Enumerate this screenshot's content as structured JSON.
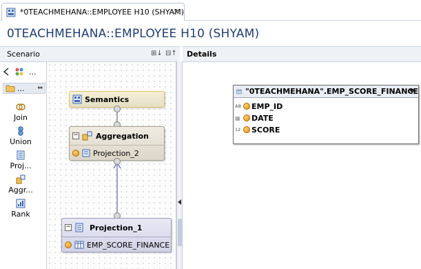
{
  "tab": {
    "label": "*0TEACHMEHANA::EMPLOYEE H10 (SHYAM)",
    "close_glyph": "✕"
  },
  "page_title": "0TEACHMEHANA::EMPLOYEE H10 (SHYAM)",
  "scenario": {
    "header": "Scenario",
    "header_buttons": [
      "⊞↓",
      "⊟↑"
    ],
    "palette_toolbar_more": "...",
    "palette_folder_label": "...",
    "tools": [
      {
        "label": "Join",
        "icon": "join-icon"
      },
      {
        "label": "Union",
        "icon": "union-icon"
      },
      {
        "label": "Proj...",
        "icon": "projection-icon"
      },
      {
        "label": "Aggr...",
        "icon": "aggregation-icon"
      },
      {
        "label": "Rank",
        "icon": "rank-icon"
      }
    ],
    "nodes": {
      "semantics": {
        "title": "Semantics"
      },
      "aggregation": {
        "title": "Aggregation",
        "input": "Projection_2"
      },
      "projection_1": {
        "title": "Projection_1",
        "input": "EMP_SCORE_FINANCE"
      }
    }
  },
  "details": {
    "header": "Details",
    "table": {
      "name": "\"0TEACHMEHANA\".EMP_SCORE_FINANCE",
      "columns": [
        {
          "name": "EMP_ID",
          "type_tag": "AB"
        },
        {
          "name": "DATE",
          "type_tag": "▦"
        },
        {
          "name": "SCORE",
          "type_tag": "12"
        }
      ]
    }
  }
}
